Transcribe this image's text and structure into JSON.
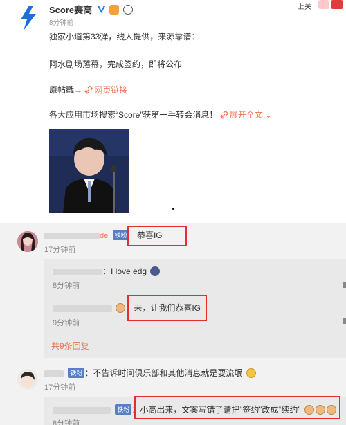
{
  "post": {
    "author": "Score赛高",
    "time": "8分钟前",
    "topright_text": "上关",
    "lines": [
      "独家小道第33弹，线人提供，来源靠谱：",
      "阿水剧场落幕，完成签约，即将公布"
    ],
    "origin_label": "原帖戳→",
    "web_link": "网页链接",
    "promo_text": "各大应用市场搜索“Score”获第一手转会消息！",
    "expand_label": "展开全文"
  },
  "comments": [
    {
      "name_fragment": "de",
      "badge": "铁粉",
      "text": "恭喜IG",
      "time": "17分钟前",
      "replies": [
        {
          "text": "：I love edg",
          "time": "8分钟前"
        },
        {
          "text": "：来，让我们恭喜IG",
          "time": "9分钟前"
        }
      ],
      "more_replies": "共9条回复"
    },
    {
      "badge": "铁粉",
      "text": "：不告诉时间俱乐部和其他消息就是耍流氓",
      "time": "17分钟前",
      "reply": {
        "badge": "铁粉",
        "text": "：小高出来，文案写错了请把“签约”改成“续约”",
        "time": "8分钟前"
      }
    }
  ],
  "colors": {
    "accent": "#eb7350",
    "highlight_box": "#e03030",
    "fan_badge": "#5a7ec5",
    "logo": "#1c6fd6"
  }
}
